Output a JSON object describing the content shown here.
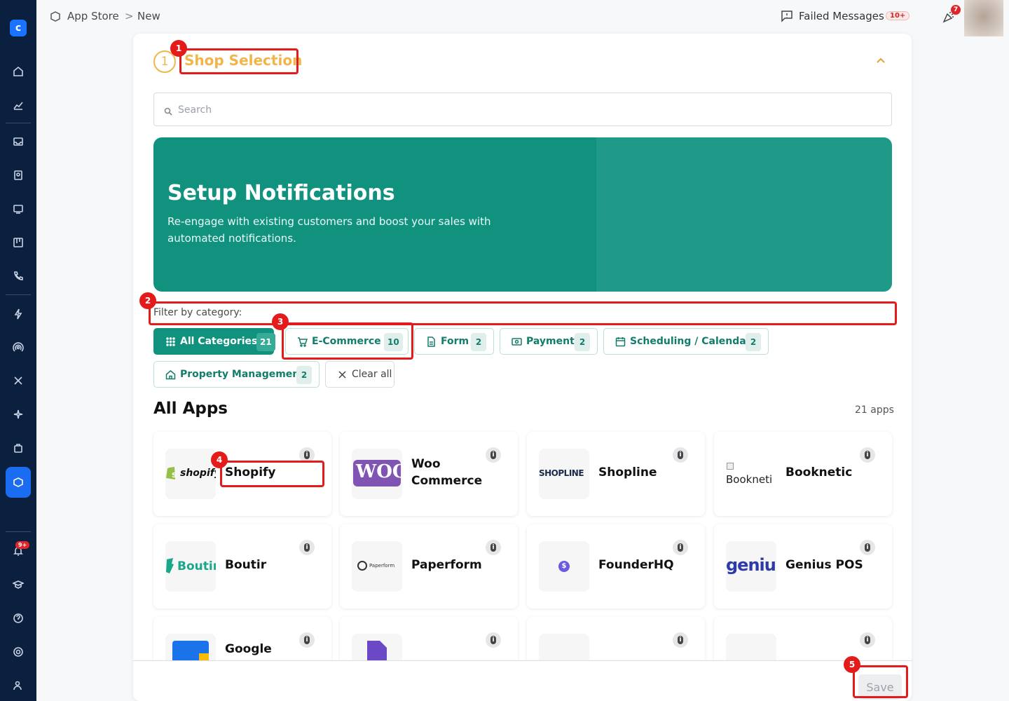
{
  "topbar": {
    "breadcrumb": [
      "App Store",
      "New"
    ],
    "failed_messages_label": "Failed Messages",
    "failed_messages_badge": "10+",
    "notifications_badge": "7"
  },
  "sidebar": {
    "notification_badge": "9+"
  },
  "section": {
    "step_number": "1",
    "title": "Shop Selection"
  },
  "search": {
    "placeholder": "Search"
  },
  "banner": {
    "title": "Setup Notifications",
    "subtitle": "Re-engage with existing customers and boost your sales with automated notifications."
  },
  "filter": {
    "label": "Filter by category:",
    "categories": [
      {
        "label": "All Categories",
        "count": "21",
        "icon": "grid-icon",
        "active": true
      },
      {
        "label": "E-Commerce",
        "count": "10",
        "icon": "cart-icon"
      },
      {
        "label": "Form",
        "count": "2",
        "icon": "document-icon"
      },
      {
        "label": "Payment",
        "count": "2",
        "icon": "money-icon"
      },
      {
        "label": "Scheduling / Calendar",
        "count": "2",
        "icon": "calendar-icon"
      },
      {
        "label": "Property Management",
        "count": "2",
        "icon": "home-icon"
      }
    ],
    "clear_label": "Clear all"
  },
  "apps": {
    "heading": "All Apps",
    "count_label": "21 apps",
    "items": [
      {
        "name": "Shopify",
        "logo_text": "shopify"
      },
      {
        "name": "Woo Commerce",
        "logo_text": "WOO"
      },
      {
        "name": "Shopline",
        "logo_text": "SHOPLINE"
      },
      {
        "name": "Booknetic",
        "logo_text": "Bookneti"
      },
      {
        "name": "Boutir",
        "logo_text": "Boutir"
      },
      {
        "name": "Paperform",
        "logo_text": "Paperform"
      },
      {
        "name": "FounderHQ",
        "logo_text": "$"
      },
      {
        "name": "Genius POS",
        "logo_text": "genius"
      },
      {
        "name": "Google",
        "logo_text": ""
      },
      {
        "name": "",
        "logo_text": ""
      },
      {
        "name": "",
        "logo_text": ""
      },
      {
        "name": "",
        "logo_text": ""
      }
    ]
  },
  "footer": {
    "save_label": "Save"
  },
  "annotations": [
    "1",
    "2",
    "3",
    "4",
    "5"
  ],
  "colors": {
    "sidebar": "#0b1f3f",
    "accent": "#10927f",
    "step": "#f0b64a",
    "annotation": "#e41b1b"
  }
}
